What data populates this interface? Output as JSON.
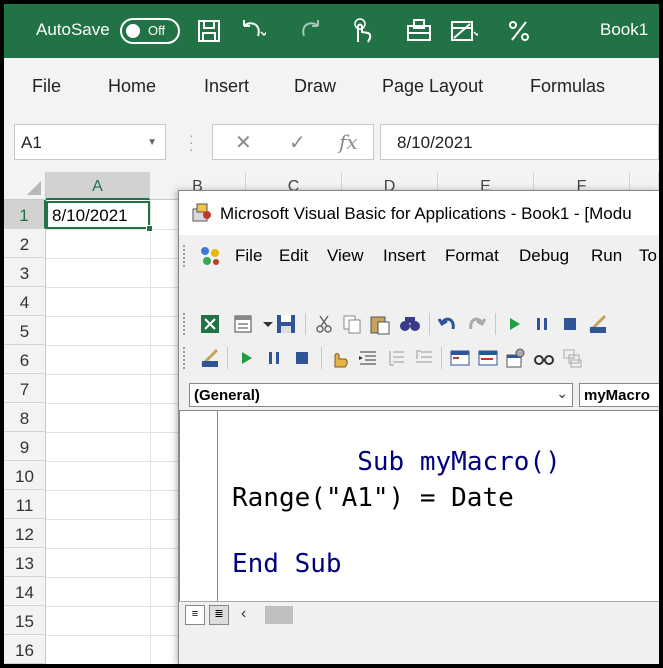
{
  "titlebar": {
    "autosave_label": "AutoSave",
    "toggle_state": "Off",
    "book_title": "Book1",
    "accent_color": "#217346",
    "quick_access_icons": [
      "save-icon",
      "undo-icon",
      "redo-icon",
      "touch-mode-icon",
      "form-icon",
      "table-icon",
      "percent-icon"
    ]
  },
  "ribbon": {
    "tabs": [
      "File",
      "Home",
      "Insert",
      "Draw",
      "Page Layout",
      "Formulas"
    ]
  },
  "formula_bar": {
    "name_box": "A1",
    "fx_label": "fx",
    "value": "8/10/2021"
  },
  "sheet": {
    "columns": [
      "A",
      "B",
      "C",
      "D",
      "E",
      "F"
    ],
    "rows": [
      "1",
      "2",
      "3",
      "4",
      "5",
      "6",
      "7",
      "8",
      "9",
      "10",
      "11",
      "12",
      "13",
      "14",
      "15",
      "16"
    ],
    "a1_value": "8/10/2021"
  },
  "vba": {
    "title": "Microsoft Visual Basic for Applications - Book1 - [Modu",
    "menu": [
      "File",
      "Edit",
      "View",
      "Insert",
      "Format",
      "Debug",
      "Run",
      "To"
    ],
    "object_combo": "(General)",
    "procedure_combo": "myMacro",
    "code": {
      "line1_kw": "Sub",
      "line1_rest": " myMacro()",
      "line2": "Range(\"A1\") = Date",
      "line3_kw": "End Sub"
    }
  }
}
